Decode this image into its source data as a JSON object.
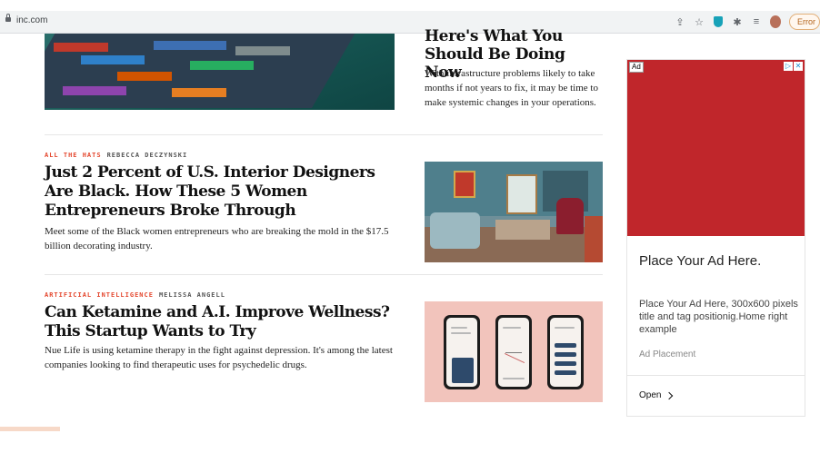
{
  "browser": {
    "url": "inc.com",
    "error_label": "Error"
  },
  "top_article": {
    "headline": "Here's What You Should Be Doing Now",
    "dek": "With infrastructure problems likely to take months if not years to fix, it may be time to make systemic changes in your operations."
  },
  "articles": [
    {
      "category": "ALL THE HATS",
      "author": "REBECCA DECZYNSKI",
      "headline": "Just 2 Percent of U.S. Interior Designers Are Black. How These 5 Women Entrepreneurs Broke Through",
      "dek": "Meet some of the Black women entrepreneurs who are breaking the mold in the $17.5 billion decorating industry."
    },
    {
      "category": "ARTIFICIAL INTELLIGENCE",
      "author": "MELISSA ANGELL",
      "headline": "Can Ketamine and A.I. Improve Wellness? This Startup Wants to Try",
      "dek": "Nue Life is using ketamine therapy in the fight against depression. It's among the latest companies looking to find therapeutic uses for psychedelic drugs."
    }
  ],
  "ad": {
    "badge": "Ad",
    "title": "Place Your Ad Here.",
    "description": "Place Your Ad Here, 300x600 pixels title and tag positionig.Home right example",
    "placement": "Ad Placement",
    "cta": "Open",
    "color": "#c0262b"
  },
  "colors": {
    "accent": "#e4482f"
  }
}
